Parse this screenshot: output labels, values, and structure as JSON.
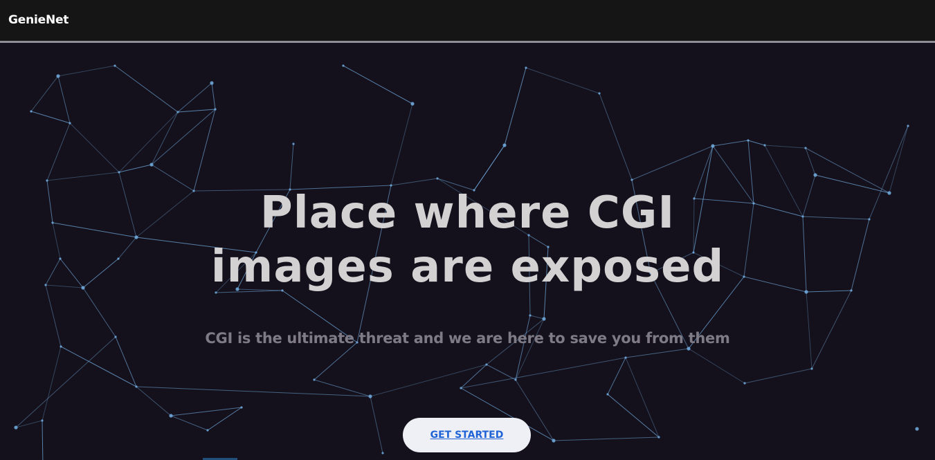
{
  "navbar": {
    "brand": "GenieNet"
  },
  "hero": {
    "headline_line1": "Place where CGI",
    "headline_line2": "images are exposed",
    "subheadline": "CGI is the ultimate threat and we are here to save you from them",
    "cta_label": "GET STARTED"
  },
  "colors": {
    "background": "#15111c",
    "navbar": "#151515",
    "network_line": "#6ea6d8",
    "headline": "#d3d1d2",
    "subheadline": "#7f7b86",
    "cta_background": "#eef0f6",
    "cta_text": "#1f63d6"
  }
}
